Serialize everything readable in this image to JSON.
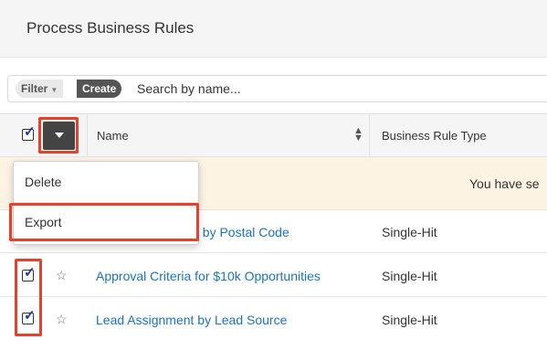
{
  "header": {
    "title": "Process Business Rules"
  },
  "filter_bar": {
    "filter_label": "Filter",
    "create_label": "Create",
    "search_placeholder": "Search by name..."
  },
  "table": {
    "columns": {
      "name": "Name",
      "type": "Business Rule Type"
    },
    "alert_text": "You have se",
    "rows": [
      {
        "name": "t by Postal Code",
        "type": "Single-Hit",
        "checked": false
      },
      {
        "name": "Approval Criteria for $10k Opportunities",
        "type": "Single-Hit",
        "checked": true
      },
      {
        "name": "Lead Assignment by Lead Source",
        "type": "Single-Hit",
        "checked": true
      }
    ]
  },
  "actions_menu": {
    "items": [
      "Delete",
      "Export"
    ]
  },
  "colors": {
    "highlight": "#e8402a",
    "link": "#1a73c9",
    "alert_bg": "#fcf3e3"
  },
  "icons": {
    "select_all": "checkbox-checked-icon",
    "actions": "caret-down-icon",
    "sort": "sort-icon",
    "favorite": "star-outline-icon"
  }
}
